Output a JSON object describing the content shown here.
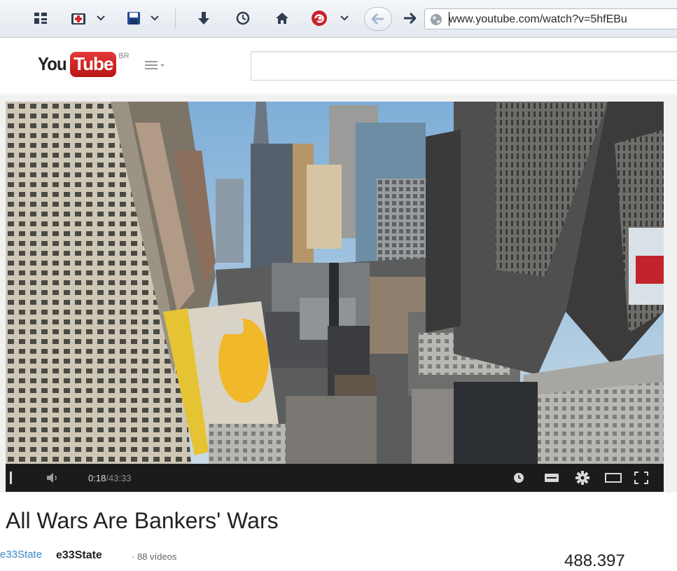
{
  "browser": {
    "url": "www.youtube.com/watch?v=5hfEBu"
  },
  "youtube": {
    "logo_you": "You",
    "logo_tube": "Tube",
    "region": "BR"
  },
  "player": {
    "current_time": "0:18",
    "separator": " / ",
    "duration": "43:33",
    "progress_fraction": 0.007
  },
  "video_info": {
    "title": "All Wars Are Bankers' Wars",
    "channel_thumb_text": "e33State",
    "channel_name": "e33State",
    "video_count": "· 88 vídeos",
    "views": "488.397"
  },
  "icons": {
    "toolbar": [
      "grid-icon",
      "first-aid-icon",
      "save-icon",
      "download-icon",
      "history-icon",
      "home-icon",
      "addon-icon",
      "back-icon",
      "forward-icon",
      "globe-icon"
    ],
    "player": [
      "pause-icon",
      "volume-icon",
      "watch-later-icon",
      "captions-icon",
      "settings-icon",
      "theater-icon",
      "fullscreen-icon"
    ]
  },
  "colors": {
    "youtube_red": "#cc181e",
    "link_blue": "#3b87c8"
  }
}
